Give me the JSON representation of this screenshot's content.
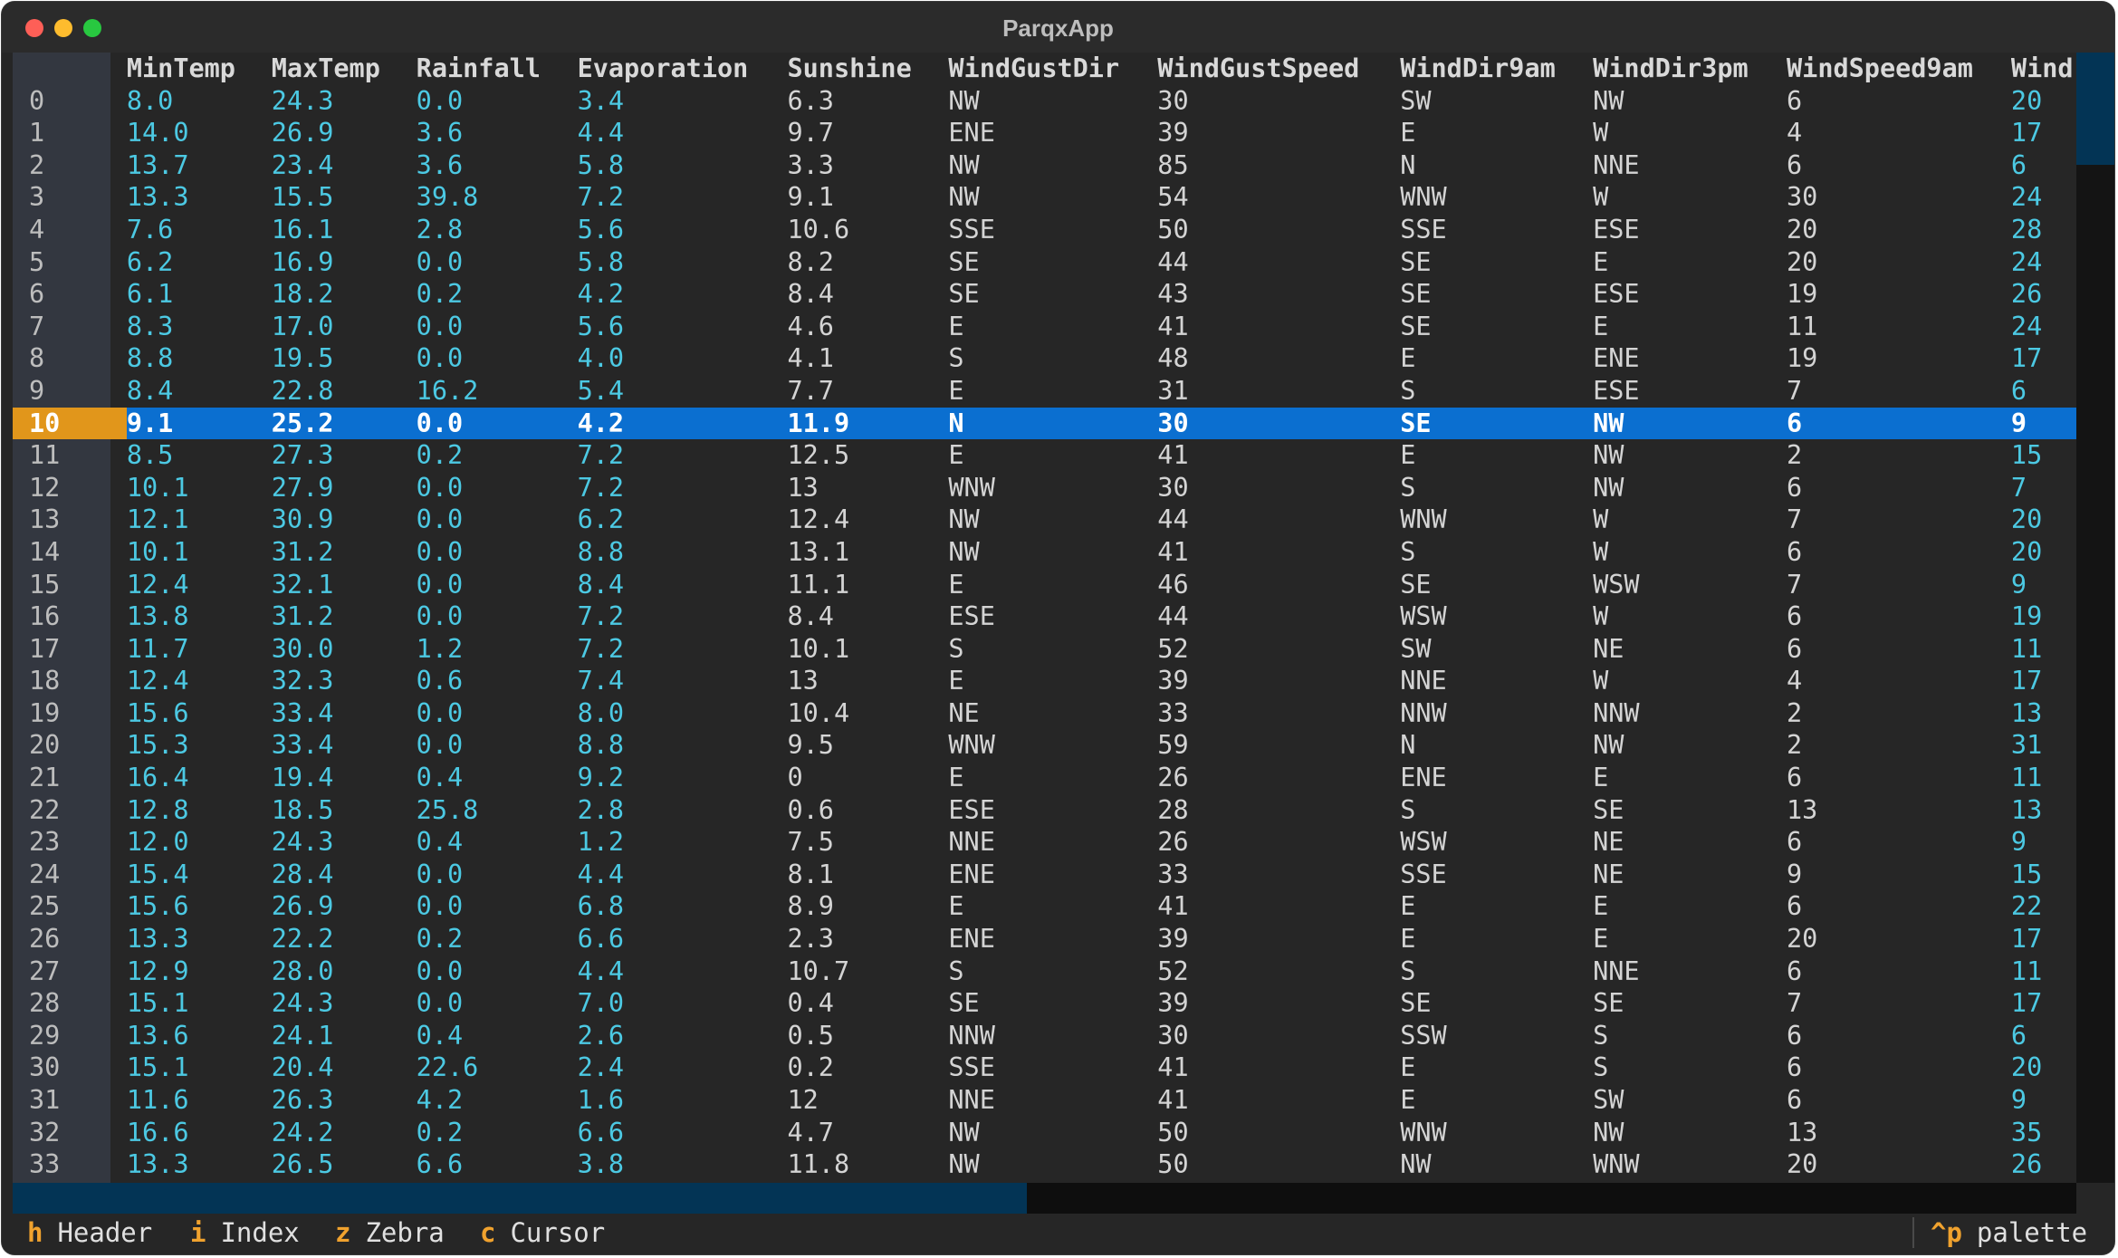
{
  "window": {
    "title": "ParqxApp"
  },
  "columns": [
    "MinTemp",
    "MaxTemp",
    "Rainfall",
    "Evaporation",
    "Sunshine",
    "WindGustDir",
    "WindGustSpeed",
    "WindDir9am",
    "WindDir3pm",
    "WindSpeed9am",
    "Wind"
  ],
  "numeric_columns": [
    0,
    1,
    2,
    3,
    10
  ],
  "cursor_row": 10,
  "rows": [
    [
      "0",
      "8.0",
      "24.3",
      "0.0",
      "3.4",
      "6.3",
      "NW",
      "30",
      "SW",
      "NW",
      "6",
      "20"
    ],
    [
      "1",
      "14.0",
      "26.9",
      "3.6",
      "4.4",
      "9.7",
      "ENE",
      "39",
      "E",
      "W",
      "4",
      "17"
    ],
    [
      "2",
      "13.7",
      "23.4",
      "3.6",
      "5.8",
      "3.3",
      "NW",
      "85",
      "N",
      "NNE",
      "6",
      "6"
    ],
    [
      "3",
      "13.3",
      "15.5",
      "39.8",
      "7.2",
      "9.1",
      "NW",
      "54",
      "WNW",
      "W",
      "30",
      "24"
    ],
    [
      "4",
      "7.6",
      "16.1",
      "2.8",
      "5.6",
      "10.6",
      "SSE",
      "50",
      "SSE",
      "ESE",
      "20",
      "28"
    ],
    [
      "5",
      "6.2",
      "16.9",
      "0.0",
      "5.8",
      "8.2",
      "SE",
      "44",
      "SE",
      "E",
      "20",
      "24"
    ],
    [
      "6",
      "6.1",
      "18.2",
      "0.2",
      "4.2",
      "8.4",
      "SE",
      "43",
      "SE",
      "ESE",
      "19",
      "26"
    ],
    [
      "7",
      "8.3",
      "17.0",
      "0.0",
      "5.6",
      "4.6",
      "E",
      "41",
      "SE",
      "E",
      "11",
      "24"
    ],
    [
      "8",
      "8.8",
      "19.5",
      "0.0",
      "4.0",
      "4.1",
      "S",
      "48",
      "E",
      "ENE",
      "19",
      "17"
    ],
    [
      "9",
      "8.4",
      "22.8",
      "16.2",
      "5.4",
      "7.7",
      "E",
      "31",
      "S",
      "ESE",
      "7",
      "6"
    ],
    [
      "10",
      "9.1",
      "25.2",
      "0.0",
      "4.2",
      "11.9",
      "N",
      "30",
      "SE",
      "NW",
      "6",
      "9"
    ],
    [
      "11",
      "8.5",
      "27.3",
      "0.2",
      "7.2",
      "12.5",
      "E",
      "41",
      "E",
      "NW",
      "2",
      "15"
    ],
    [
      "12",
      "10.1",
      "27.9",
      "0.0",
      "7.2",
      "13",
      "WNW",
      "30",
      "S",
      "NW",
      "6",
      "7"
    ],
    [
      "13",
      "12.1",
      "30.9",
      "0.0",
      "6.2",
      "12.4",
      "NW",
      "44",
      "WNW",
      "W",
      "7",
      "20"
    ],
    [
      "14",
      "10.1",
      "31.2",
      "0.0",
      "8.8",
      "13.1",
      "NW",
      "41",
      "S",
      "W",
      "6",
      "20"
    ],
    [
      "15",
      "12.4",
      "32.1",
      "0.0",
      "8.4",
      "11.1",
      "E",
      "46",
      "SE",
      "WSW",
      "7",
      "9"
    ],
    [
      "16",
      "13.8",
      "31.2",
      "0.0",
      "7.2",
      "8.4",
      "ESE",
      "44",
      "WSW",
      "W",
      "6",
      "19"
    ],
    [
      "17",
      "11.7",
      "30.0",
      "1.2",
      "7.2",
      "10.1",
      "S",
      "52",
      "SW",
      "NE",
      "6",
      "11"
    ],
    [
      "18",
      "12.4",
      "32.3",
      "0.6",
      "7.4",
      "13",
      "E",
      "39",
      "NNE",
      "W",
      "4",
      "17"
    ],
    [
      "19",
      "15.6",
      "33.4",
      "0.0",
      "8.0",
      "10.4",
      "NE",
      "33",
      "NNW",
      "NNW",
      "2",
      "13"
    ],
    [
      "20",
      "15.3",
      "33.4",
      "0.0",
      "8.8",
      "9.5",
      "WNW",
      "59",
      "N",
      "NW",
      "2",
      "31"
    ],
    [
      "21",
      "16.4",
      "19.4",
      "0.4",
      "9.2",
      "0",
      "E",
      "26",
      "ENE",
      "E",
      "6",
      "11"
    ],
    [
      "22",
      "12.8",
      "18.5",
      "25.8",
      "2.8",
      "0.6",
      "ESE",
      "28",
      "S",
      "SE",
      "13",
      "13"
    ],
    [
      "23",
      "12.0",
      "24.3",
      "0.4",
      "1.2",
      "7.5",
      "NNE",
      "26",
      "WSW",
      "NE",
      "6",
      "9"
    ],
    [
      "24",
      "15.4",
      "28.4",
      "0.0",
      "4.4",
      "8.1",
      "ENE",
      "33",
      "SSE",
      "NE",
      "9",
      "15"
    ],
    [
      "25",
      "15.6",
      "26.9",
      "0.0",
      "6.8",
      "8.9",
      "E",
      "41",
      "E",
      "E",
      "6",
      "22"
    ],
    [
      "26",
      "13.3",
      "22.2",
      "0.2",
      "6.6",
      "2.3",
      "ENE",
      "39",
      "E",
      "E",
      "20",
      "17"
    ],
    [
      "27",
      "12.9",
      "28.0",
      "0.0",
      "4.4",
      "10.7",
      "S",
      "52",
      "S",
      "NNE",
      "6",
      "11"
    ],
    [
      "28",
      "15.1",
      "24.3",
      "0.0",
      "7.0",
      "0.4",
      "SE",
      "39",
      "SE",
      "SE",
      "7",
      "17"
    ],
    [
      "29",
      "13.6",
      "24.1",
      "0.4",
      "2.6",
      "0.5",
      "NNW",
      "30",
      "SSW",
      "S",
      "6",
      "6"
    ],
    [
      "30",
      "15.1",
      "20.4",
      "22.6",
      "2.4",
      "0.2",
      "SSE",
      "41",
      "E",
      "S",
      "6",
      "20"
    ],
    [
      "31",
      "11.6",
      "26.3",
      "4.2",
      "1.6",
      "12",
      "NNE",
      "41",
      "E",
      "SW",
      "6",
      "9"
    ],
    [
      "32",
      "16.6",
      "24.2",
      "0.2",
      "6.6",
      "4.7",
      "NW",
      "50",
      "WNW",
      "NW",
      "13",
      "35"
    ],
    [
      "33",
      "13.3",
      "26.5",
      "6.6",
      "3.8",
      "11.8",
      "NW",
      "50",
      "NW",
      "WNW",
      "20",
      "26"
    ]
  ],
  "footer": {
    "bindings": [
      {
        "key": "h",
        "label": "Header"
      },
      {
        "key": "i",
        "label": "Index"
      },
      {
        "key": "z",
        "label": "Zebra"
      },
      {
        "key": "c",
        "label": "Cursor"
      }
    ],
    "palette": {
      "key": "^p",
      "label": "palette"
    }
  },
  "colors": {
    "background": "#262626",
    "index_strip": "#333740",
    "numeric_text": "#4cc9e3",
    "cursor_row": "#0b6fd0",
    "cursor_index": "#e1961b",
    "footer_key": "#f0a22e",
    "scrollbar_thumb": "#033455"
  }
}
